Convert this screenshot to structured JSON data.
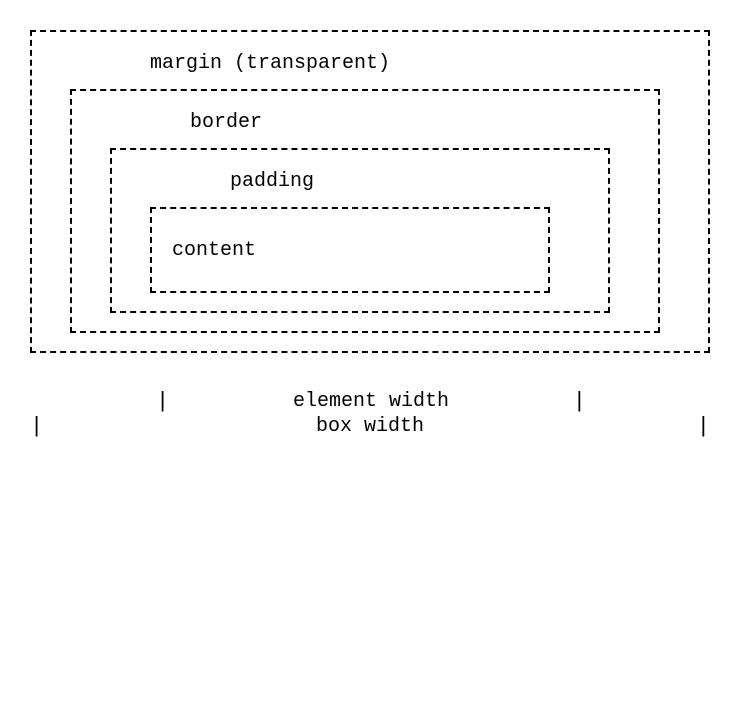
{
  "diagram": {
    "margin_label": "margin (transparent)",
    "border_label": "border",
    "padding_label": "padding",
    "content_label": "content",
    "element_width_label": "element width",
    "box_width_label": "box width",
    "marker": "|"
  }
}
